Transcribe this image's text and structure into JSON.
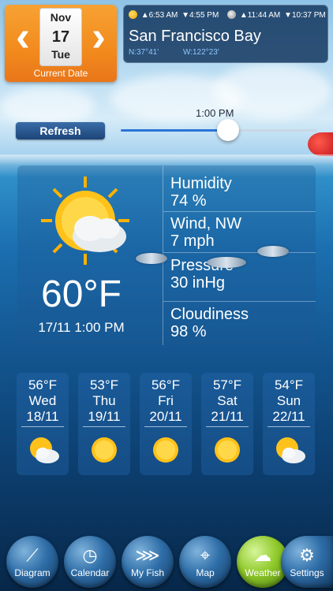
{
  "date": {
    "month": "Nov",
    "day": "17",
    "weekday": "Tue",
    "label": "Current Date",
    "prev_icon": "chevron-left-icon",
    "next_icon": "chevron-right-icon"
  },
  "location": {
    "sunrise": "▲6:53 AM",
    "sunset": "▼4:55 PM",
    "moonrise": "▲11:44 AM",
    "moonset": "▼10:37 PM",
    "name": "San Francisco Bay",
    "lat": "N:37°41'",
    "lon": "W:122°23'"
  },
  "refresh_label": "Refresh",
  "slider": {
    "time": "1:00 PM",
    "value": 0.55
  },
  "current": {
    "temperature": "60°F",
    "datetime": "17/11 1:00 PM",
    "humidity_label": "Humidity",
    "humidity_value": "74 %",
    "wind_label": "Wind, NW",
    "wind_value": "7 mph",
    "pressure_label": "Pressure",
    "pressure_value": "30 inHg",
    "cloudiness_label": "Cloudiness",
    "cloudiness_value": "98 %"
  },
  "forecast": [
    {
      "temp": "56°F",
      "day": "Wed",
      "date": "18/11",
      "icon": "partly-cloudy-icon"
    },
    {
      "temp": "53°F",
      "day": "Thu",
      "date": "19/11",
      "icon": "sun-icon"
    },
    {
      "temp": "56°F",
      "day": "Fri",
      "date": "20/11",
      "icon": "sun-icon"
    },
    {
      "temp": "57°F",
      "day": "Sat",
      "date": "21/11",
      "icon": "sun-icon"
    },
    {
      "temp": "54°F",
      "day": "Sun",
      "date": "22/11",
      "icon": "partly-cloudy-icon"
    }
  ],
  "nav": [
    {
      "label": "Diagram",
      "icon": "chart-icon"
    },
    {
      "label": "Calendar",
      "icon": "clock-calendar-icon"
    },
    {
      "label": "My Fish",
      "icon": "fish-icon"
    },
    {
      "label": "Map",
      "icon": "map-pin-icon"
    },
    {
      "label": "Weather",
      "icon": "weather-icon"
    },
    {
      "label": "Settings",
      "icon": "gear-icon"
    }
  ],
  "colors": {
    "accent_orange": "#f28a1d",
    "nav_active": "#8fc92a",
    "slider_fill": "#2a74d8"
  }
}
